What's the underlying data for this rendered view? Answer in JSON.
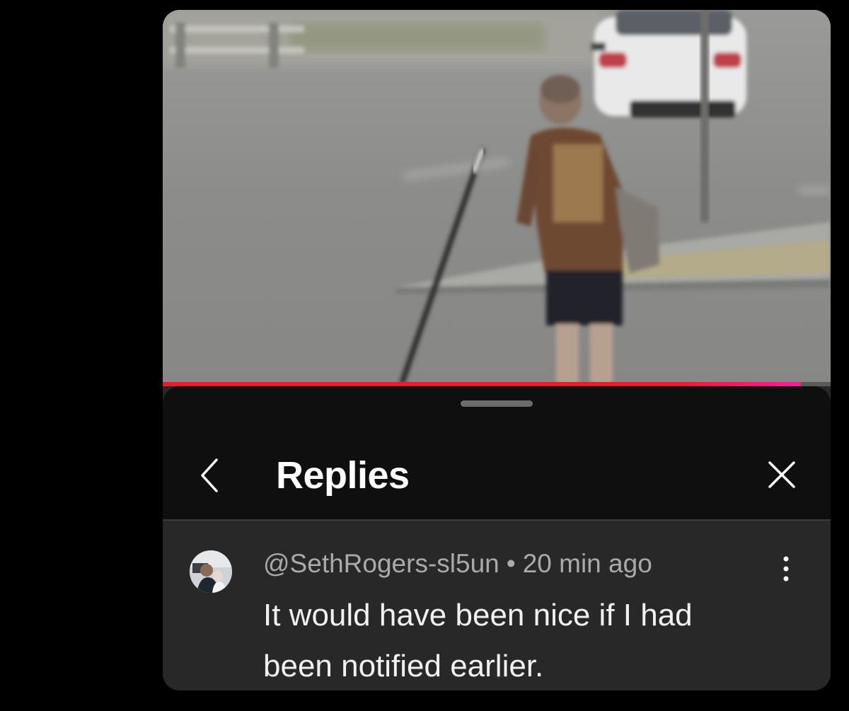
{
  "video": {
    "progress_fraction": 0.955,
    "progress_color": "#e0202a"
  },
  "sheet": {
    "back_icon": "chevron-left-icon",
    "title": "Replies",
    "close_icon": "close-icon"
  },
  "comment": {
    "author": "@SethRogers-sl5un",
    "separator": "•",
    "time": "20 min ago",
    "text": "It would have been nice if I had been notified earlier.",
    "more_icon": "more-vertical-icon"
  }
}
